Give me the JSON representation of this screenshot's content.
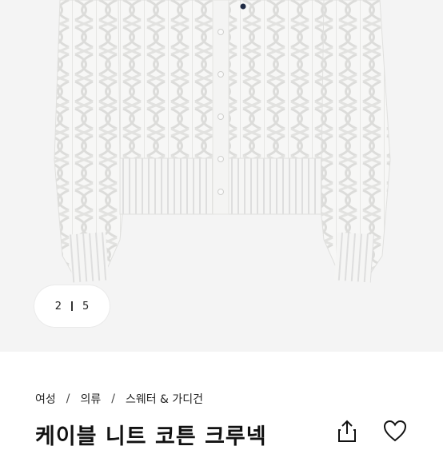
{
  "hero": {
    "image_alt": "white cable knit cardigan product photo",
    "pager": {
      "current": "2",
      "total": "5"
    }
  },
  "breadcrumb": {
    "items": [
      "여성",
      "의류",
      "스웨터 & 가디건"
    ],
    "separator": "/"
  },
  "product": {
    "title": "케이블 니트 코튼 크루넥"
  },
  "icons": {
    "share": "share-icon",
    "favorite": "heart-icon"
  },
  "colors": {
    "background": "#ffffff",
    "hero_background": "#f4f4f4",
    "text": "#111111"
  }
}
